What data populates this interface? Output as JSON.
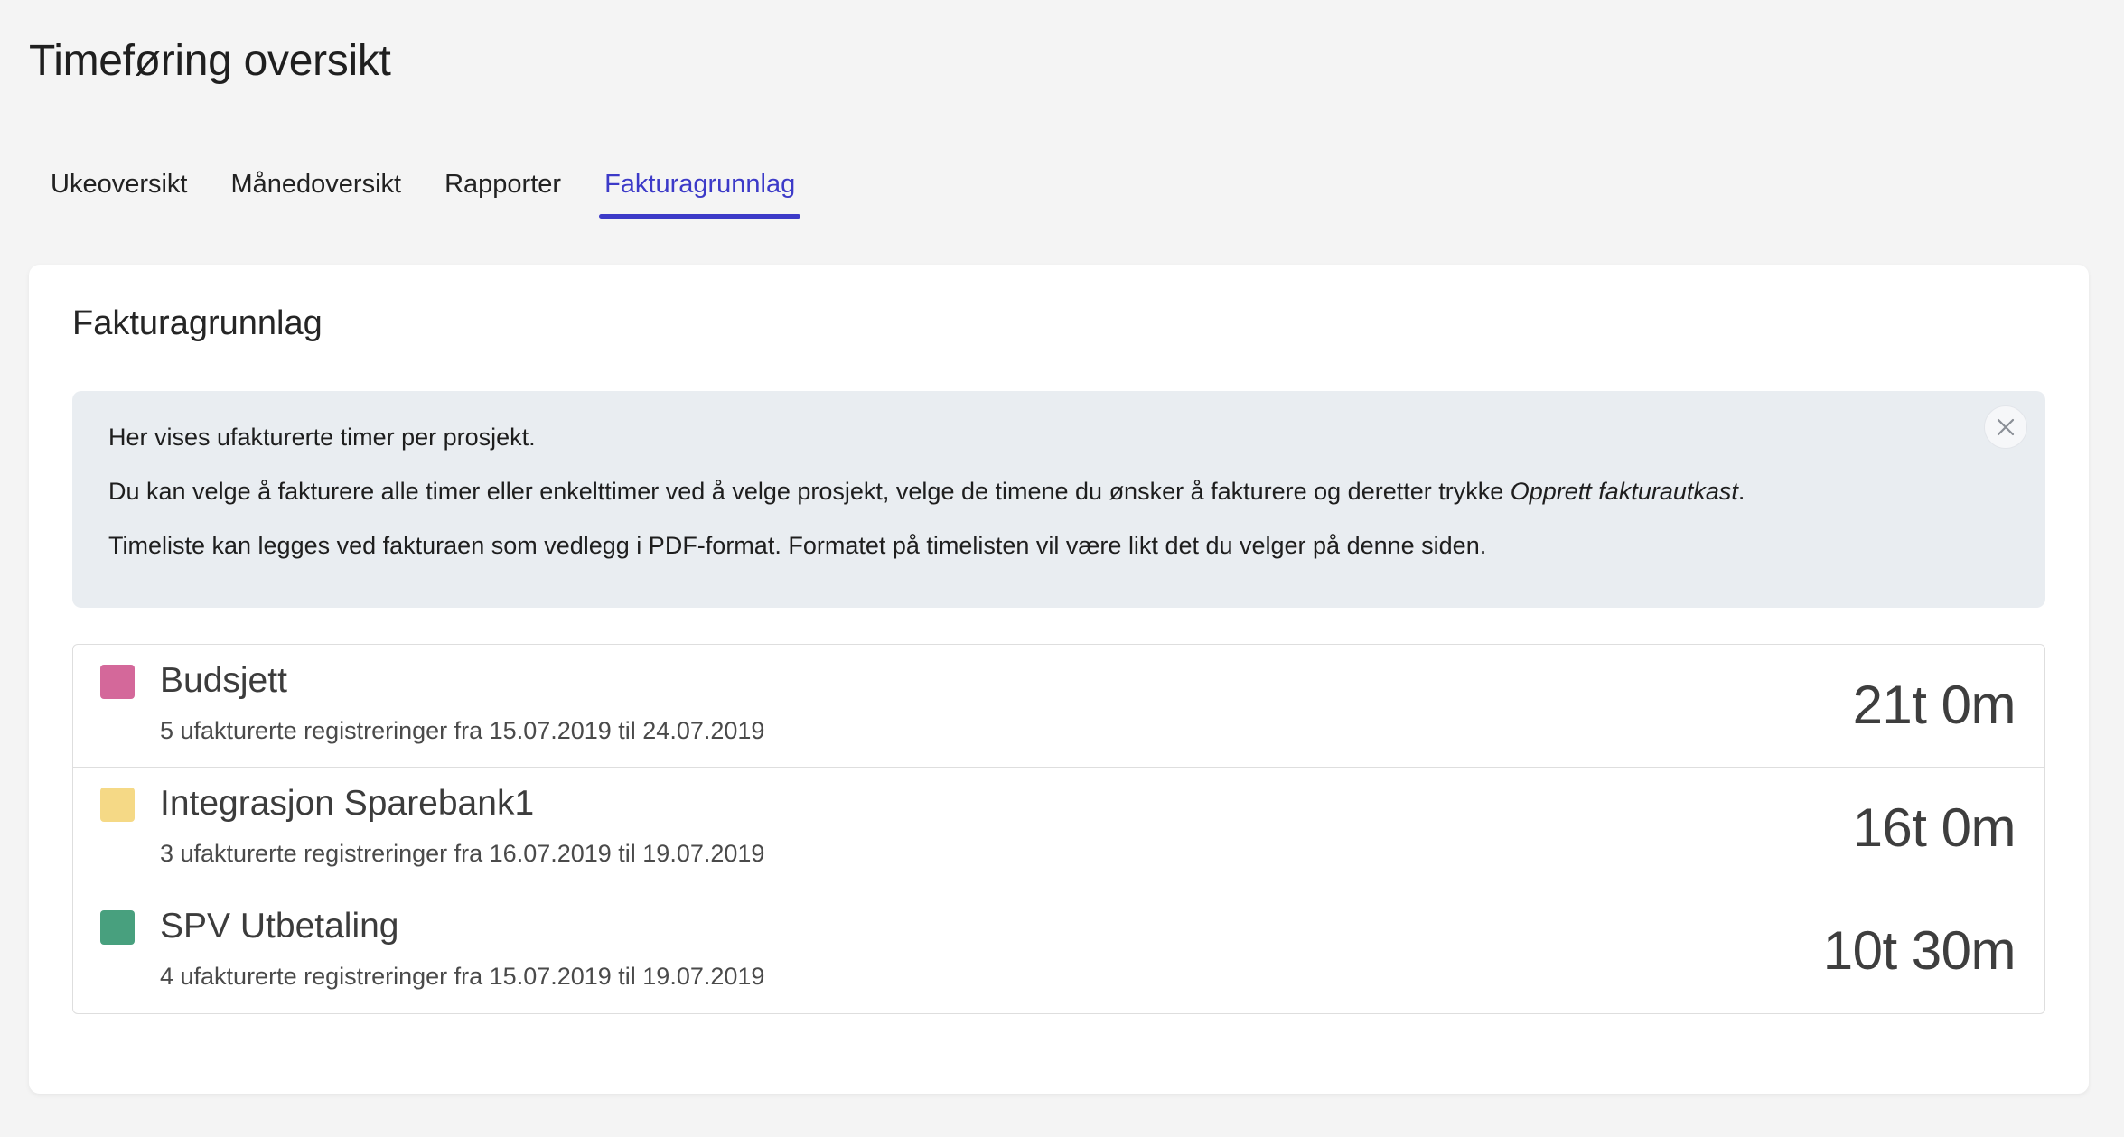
{
  "header": {
    "title": "Timeføring oversikt"
  },
  "tabs": [
    {
      "label": "Ukeoversikt",
      "active": false
    },
    {
      "label": "Månedoversikt",
      "active": false
    },
    {
      "label": "Rapporter",
      "active": false
    },
    {
      "label": "Fakturagrunnlag",
      "active": true
    }
  ],
  "colors": {
    "accent": "#3c3ac8",
    "info_bg": "#e9edf1"
  },
  "card": {
    "title": "Fakturagrunnlag",
    "info": {
      "line1": "Her vises ufakturerte timer per prosjekt.",
      "line2_prefix": "Du kan velge å fakturere alle timer eller enkelttimer ved å velge prosjekt, velge de timene du ønsker å fakturere og deretter trykke ",
      "line2_emphasis": "Opprett fakturautkast",
      "line2_suffix": ".",
      "line3": "Timeliste kan legges ved fakturaen som vedlegg i PDF-format. Formatet på timelisten vil være likt det du velger på denne siden.",
      "close_icon": "close-icon"
    },
    "projects": [
      {
        "name": "Budsjett",
        "color": "#d4689a",
        "summary": "5 ufakturerte registreringer fra 15.07.2019 til 24.07.2019",
        "time": "21t 0m"
      },
      {
        "name": "Integrasjon Sparebank1",
        "color": "#f5d986",
        "summary": "3 ufakturerte registreringer fra 16.07.2019 til 19.07.2019",
        "time": "16t 0m"
      },
      {
        "name": "SPV Utbetaling",
        "color": "#48a07e",
        "summary": "4 ufakturerte registreringer fra 15.07.2019 til 19.07.2019",
        "time": "10t 30m"
      }
    ]
  }
}
